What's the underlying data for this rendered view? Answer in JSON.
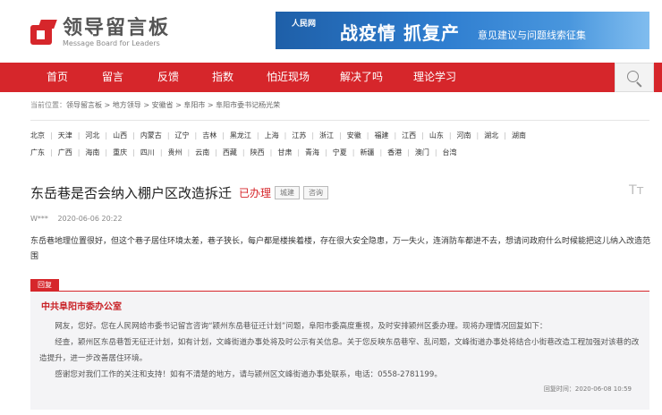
{
  "header": {
    "logo_title": "领导留言板",
    "logo_subtitle": "Message Board for Leaders",
    "banner_logo": "人民网",
    "banner_main": "战疫情  抓复产",
    "banner_sub": "意见建议与问题线索征集"
  },
  "nav": {
    "items": [
      "首页",
      "留言",
      "反馈",
      "指数",
      "怕近现场",
      "解决了吗",
      "理论学习"
    ]
  },
  "breadcrumb": {
    "label": "当前位置：",
    "path": "领导留言板 > 地方领导 > 安徽省 > 阜阳市 > 阜阳市委书记杨光荣"
  },
  "regions": {
    "row1": [
      "北京",
      "天津",
      "河北",
      "山西",
      "内蒙古",
      "辽宁",
      "吉林",
      "黑龙江",
      "上海",
      "江苏",
      "浙江",
      "安徽",
      "福建",
      "江西",
      "山东",
      "河南",
      "湖北",
      "湖南"
    ],
    "row2": [
      "广东",
      "广西",
      "海南",
      "重庆",
      "四川",
      "贵州",
      "云南",
      "西藏",
      "陕西",
      "甘肃",
      "青海",
      "宁夏",
      "新疆",
      "香港",
      "澳门",
      "台湾"
    ]
  },
  "message": {
    "title": "东岳巷是否会纳入棚户区改造拆迁",
    "status": "已办理",
    "tags": [
      "城建",
      "咨询"
    ],
    "font_toggle": "Tт",
    "author": "W***",
    "time": "2020-06-06 20:22",
    "content": "东岳巷地理位置很好，但这个巷子居住环境太差，巷子狭长，每户都是楼挨着楼，存在很大安全隐患，万一失火，连消防车都进不去，想请问政府什么时候能把这儿纳入改造范围"
  },
  "reply": {
    "badge": "回复",
    "org": "中共阜阳市委办公室",
    "paragraphs": [
      "网友，您好。您在人民网给市委书记留言咨询“颍州东岳巷征迁计划”问题，阜阳市委高度重视，及时安排颍州区委办理。现将办理情况回复如下：",
      "经查，颍州区东岳巷暂无征迁计划，如有计划，文峰街道办事处将及时公示有关信息。关于您反映东岳巷窄、乱问题，文峰街道办事处将结合小街巷改造工程加强对该巷的改造提升，进一步改善居住环境。",
      "感谢您对我们工作的关注和支持！如有不清楚的地方，请与颍州区文峰街道办事处联系，电话：0558-2781199。"
    ],
    "time": "回复时间：2020-06-08 10:59"
  },
  "colors": {
    "brand_red": "#d6262b",
    "banner_blue": "#2f7ed0"
  },
  "icons": {
    "search": "search-icon"
  }
}
